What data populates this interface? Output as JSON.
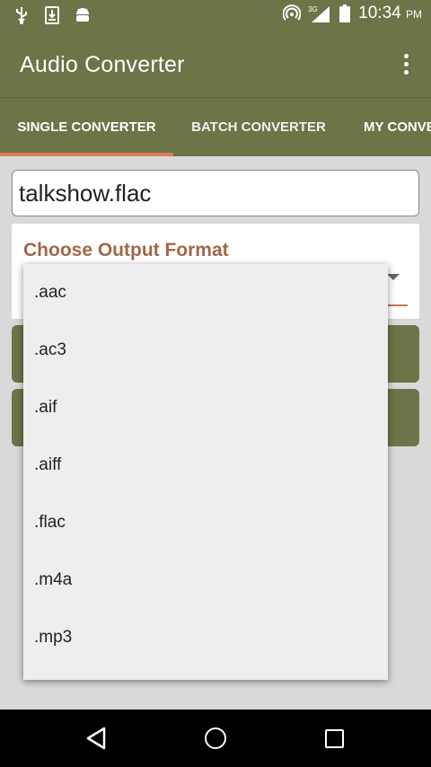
{
  "status_bar": {
    "time": "10:34",
    "ampm": "PM",
    "network": "3G",
    "icons": [
      "usb-icon",
      "download-icon",
      "android-icon",
      "hotspot-icon",
      "signal-icon",
      "battery-icon"
    ]
  },
  "toolbar": {
    "title": "Audio Converter",
    "menu_icon": "overflow-menu-icon"
  },
  "tabs": [
    {
      "label": "SINGLE CONVERTER",
      "selected": true
    },
    {
      "label": "BATCH CONVERTER",
      "selected": false
    },
    {
      "label": "MY CONVERSIONS",
      "selected": false
    }
  ],
  "file": {
    "name": "talkshow.flac"
  },
  "format": {
    "label": "Choose Output Format"
  },
  "dropdown": {
    "options": [
      ".aac",
      ".ac3",
      ".aif",
      ".aiff",
      ".flac",
      ".m4a",
      ".mp3"
    ]
  },
  "nav": {
    "back": "back-icon",
    "home": "home-icon",
    "recent": "recent-apps-icon"
  },
  "colors": {
    "primary": "#6b7548",
    "accent": "#e07a55",
    "label": "#a0674a"
  }
}
